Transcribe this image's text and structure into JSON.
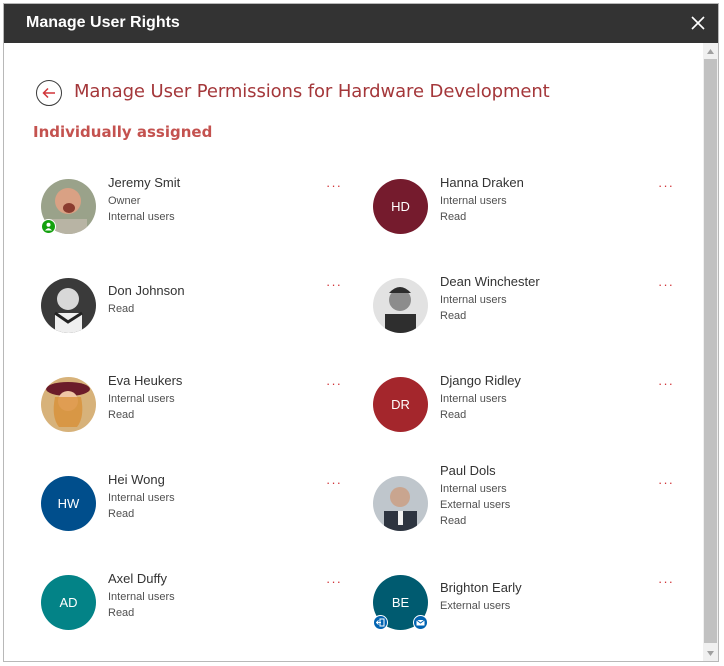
{
  "dialog": {
    "title": "Manage User Rights",
    "close_icon": "close-icon"
  },
  "page": {
    "back_icon": "back-arrow-icon",
    "title": "Manage User Permissions for Hardware Development",
    "section": "Individually assigned",
    "more_label": "···"
  },
  "colors": {
    "accent": "#a4373a",
    "titlebar": "#333333",
    "more": "#d13438"
  },
  "users": [
    {
      "name": "Jeremy Smit",
      "lines": [
        "Owner",
        "Internal users"
      ],
      "initials": "",
      "photo": true,
      "badge": "owner-person-icon"
    },
    {
      "name": "Hanna Draken",
      "lines": [
        "Internal users",
        "Read"
      ],
      "initials": "HD",
      "photo": false,
      "color": "#751b2d"
    },
    {
      "name": "Don Johnson",
      "lines": [
        "Read"
      ],
      "initials": "",
      "photo": true
    },
    {
      "name": "Dean Winchester",
      "lines": [
        "Internal users",
        "Read"
      ],
      "initials": "",
      "photo": true
    },
    {
      "name": "Eva Heukers",
      "lines": [
        "Internal users",
        "Read"
      ],
      "initials": "",
      "photo": true
    },
    {
      "name": "Django Ridley",
      "lines": [
        "Internal users",
        "Read"
      ],
      "initials": "DR",
      "photo": false,
      "color": "#a4262c"
    },
    {
      "name": "Hei Wong",
      "lines": [
        "Internal users",
        "Read"
      ],
      "initials": "HW",
      "photo": false,
      "color": "#004e8c"
    },
    {
      "name": "Paul Dols",
      "lines": [
        "Internal users",
        "External users",
        "Read"
      ],
      "initials": "",
      "photo": true
    },
    {
      "name": "Axel Duffy",
      "lines": [
        "Internal users",
        "Read"
      ],
      "initials": "AD",
      "photo": false,
      "color": "#038387"
    },
    {
      "name": "Brighton Early",
      "lines": [
        "External users"
      ],
      "initials": "BE",
      "photo": false,
      "color": "#005b70",
      "badges": [
        "external-exit-icon",
        "mail-icon"
      ]
    }
  ]
}
